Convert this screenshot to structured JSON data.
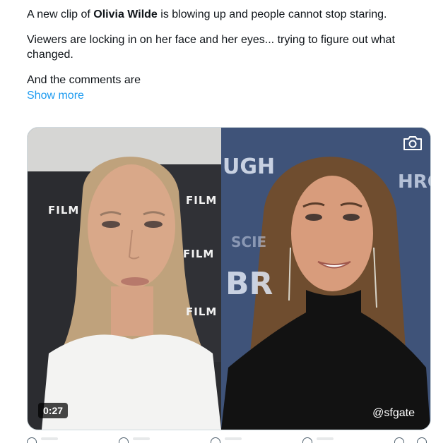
{
  "tweet": {
    "line1_before": "A new clip of ",
    "line1_bold": "Olivia Wilde",
    "line1_after": " is blowing up and people cannot stop staring.",
    "paragraph2": "Viewers are locking in on her face and her eyes... trying to figure out what changed.",
    "paragraph3": "And the comments are",
    "show_more": "Show more"
  },
  "media": {
    "duration": "0:27",
    "watermark": "@sfgate",
    "left_backdrop_logo": "FILM",
    "right_backdrop_fragments": [
      "UGH",
      "SCIE",
      "BR",
      "HRO"
    ],
    "camera_icon": "camera-icon"
  },
  "actions": {
    "icons": [
      "reply-icon",
      "retweet-icon",
      "like-icon",
      "views-icon",
      "bookmark-icon",
      "share-icon"
    ]
  },
  "colors": {
    "link": "#1d9bf0",
    "text": "#0f1419",
    "border": "#cfd9de"
  }
}
